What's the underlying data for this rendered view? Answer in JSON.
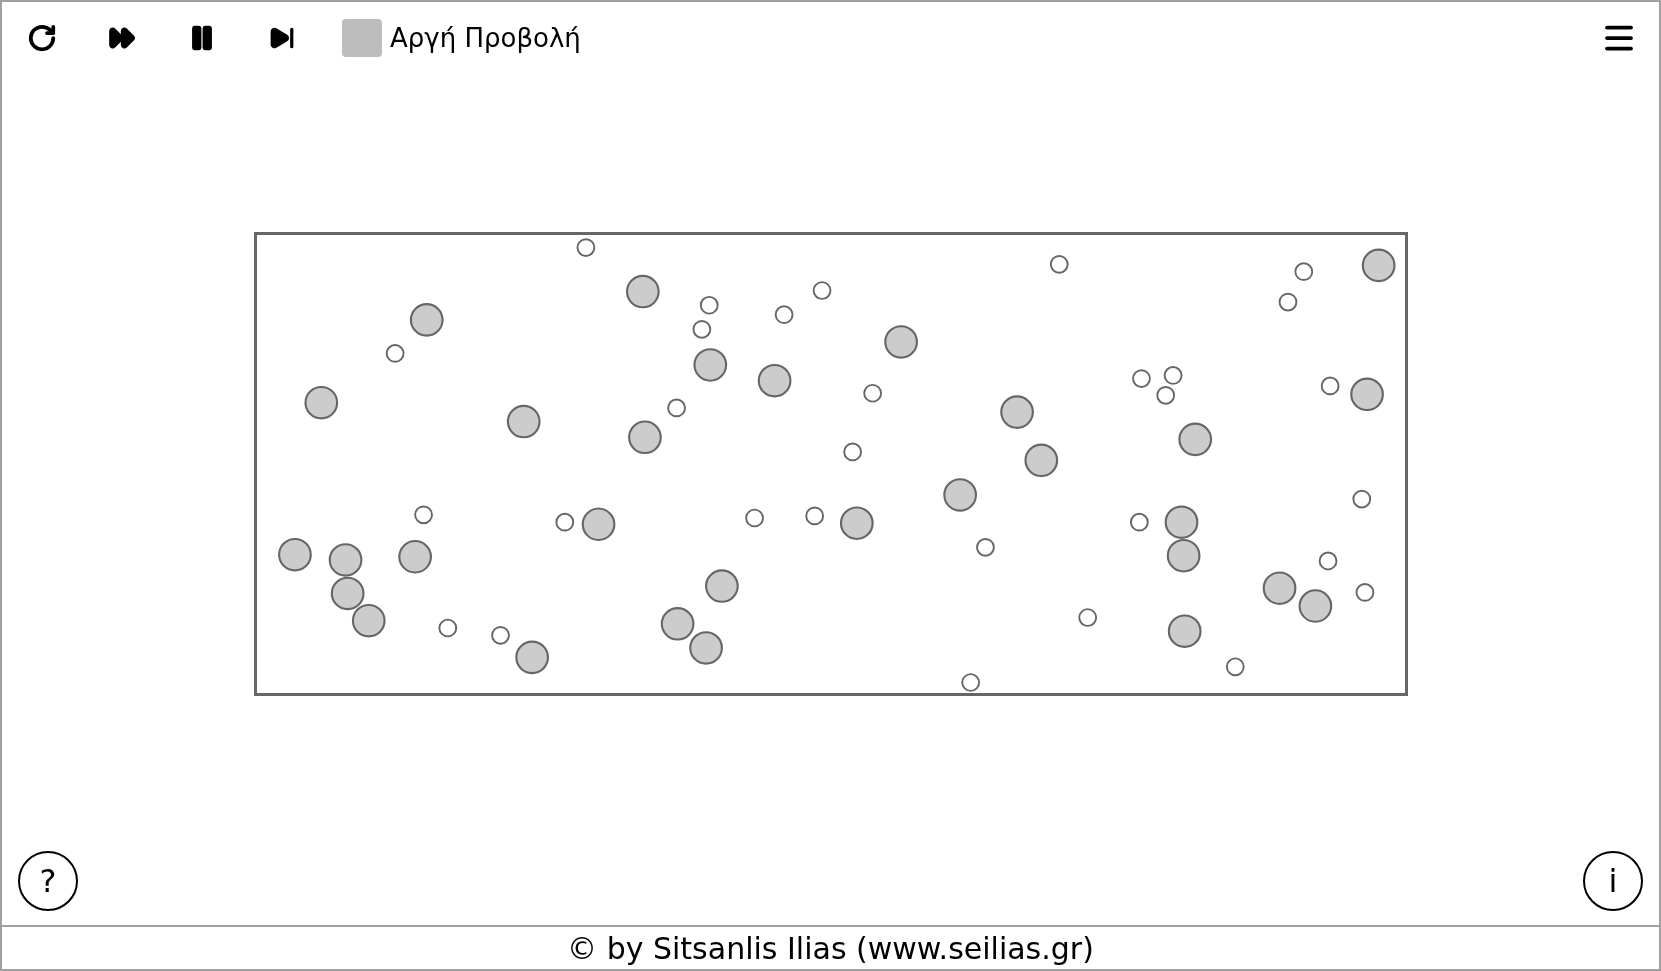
{
  "toolbar": {
    "slow_motion": {
      "label": "Αργή Προβολή",
      "checked": false
    }
  },
  "help_button": "?",
  "info_button": "i",
  "footer": "© by Sitsanlis Ilias (www.seilias.gr)"
}
